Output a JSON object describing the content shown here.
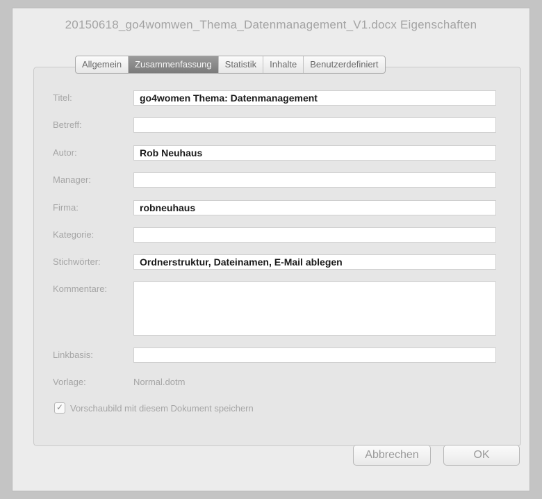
{
  "window": {
    "title": "20150618_go4womwen_Thema_Datenmanagement_V1.docx Eigenschaften"
  },
  "tabs": [
    {
      "label": "Allgemein",
      "active": false
    },
    {
      "label": "Zusammenfassung",
      "active": true
    },
    {
      "label": "Statistik",
      "active": false
    },
    {
      "label": "Inhalte",
      "active": false
    },
    {
      "label": "Benutzerdefiniert",
      "active": false
    }
  ],
  "fields": {
    "titel": {
      "label": "Titel:",
      "value": "go4women Thema: Datenmanagement"
    },
    "betreff": {
      "label": "Betreff:",
      "value": ""
    },
    "autor": {
      "label": "Autor:",
      "value": "Rob Neuhaus"
    },
    "manager": {
      "label": "Manager:",
      "value": ""
    },
    "firma": {
      "label": "Firma:",
      "value": "robneuhaus"
    },
    "kategorie": {
      "label": "Kategorie:",
      "value": ""
    },
    "stichwoerter": {
      "label": "Stichwörter:",
      "value": "Ordnerstruktur, Dateinamen, E-Mail ablegen"
    },
    "kommentare": {
      "label": "Kommentare:",
      "value": ""
    },
    "linkbasis": {
      "label": "Linkbasis:",
      "value": ""
    }
  },
  "vorlage": {
    "label": "Vorlage:",
    "value": "Normal.dotm"
  },
  "preview_checkbox": {
    "label": "Vorschaubild mit diesem Dokument speichern",
    "checked": true
  },
  "buttons": {
    "cancel": "Abbrechen",
    "ok": "OK"
  }
}
